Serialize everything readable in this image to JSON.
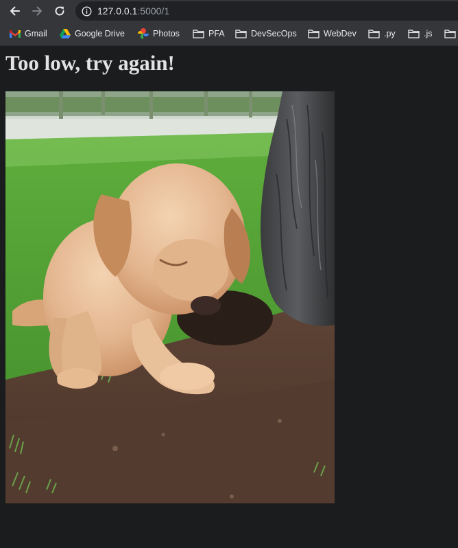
{
  "browser": {
    "url_host": "127.0.0.1",
    "url_rest": ":5000/1",
    "back_icon": "arrow-left-icon",
    "forward_icon": "arrow-right-icon",
    "reload_icon": "reload-icon",
    "info_icon": "info-icon"
  },
  "bookmarks": [
    {
      "label": "Gmail",
      "icon": "gmail-icon"
    },
    {
      "label": "Google Drive",
      "icon": "google-drive-icon"
    },
    {
      "label": "Photos",
      "icon": "google-photos-icon"
    },
    {
      "label": "PFA",
      "icon": "folder-icon"
    },
    {
      "label": "DevSecOps",
      "icon": "folder-icon"
    },
    {
      "label": "WebDev",
      "icon": "folder-icon"
    },
    {
      "label": ".py",
      "icon": "folder-icon"
    },
    {
      "label": ".js",
      "icon": "folder-icon"
    }
  ],
  "page": {
    "heading": "Too low, try again!"
  },
  "colors": {
    "page_background": "#1b1c1e",
    "toolbar": "#35363a",
    "omnibox": "#202124",
    "heading_text": "#e3e3e3"
  }
}
